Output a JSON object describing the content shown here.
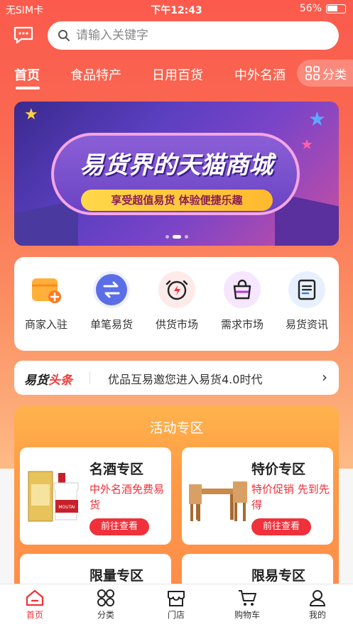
{
  "status": {
    "carrier": "无SIM卡",
    "time": "下午12:43",
    "battery": "56%"
  },
  "search": {
    "placeholder": "请输入关键字"
  },
  "tabs": [
    {
      "label": "首页"
    },
    {
      "label": "食品特产"
    },
    {
      "label": "日用百货"
    },
    {
      "label": "中外名酒"
    }
  ],
  "category_button": "分类",
  "banner": {
    "title": "易货界的天猫商城",
    "subtitle": "享受超值易货 体验便捷乐趣"
  },
  "quick_icons": [
    {
      "label": "商家入驻",
      "icon": "store-plus-icon",
      "color": "#ff9f2e"
    },
    {
      "label": "单笔易货",
      "icon": "swap-arrows-icon",
      "color": "#5b6ee8"
    },
    {
      "label": "供货市场",
      "icon": "alarm-bolt-icon",
      "color": "#f0303a"
    },
    {
      "label": "需求市场",
      "icon": "shopping-bag-icon",
      "color": "#b03ad8"
    },
    {
      "label": "易货资讯",
      "icon": "document-icon",
      "color": "#3a7ee8"
    }
  ],
  "news": {
    "brand_a": "易货",
    "brand_b": "头条",
    "text": "优品互易邀您进入易货4.0时代"
  },
  "activity": {
    "title": "活动专区",
    "cards": [
      {
        "name": "名酒专区",
        "desc": "中外名酒免费易货",
        "button": "前往查看",
        "image_label": "MOUTAI"
      },
      {
        "name": "特价专区",
        "desc": "特价促销 先到先得",
        "button": "前往查看"
      },
      {
        "name": "限量专区"
      },
      {
        "name": "限易专区"
      }
    ]
  },
  "tabbar": [
    {
      "label": "首页"
    },
    {
      "label": "分类"
    },
    {
      "label": "门店"
    },
    {
      "label": "购物车"
    },
    {
      "label": "我的"
    }
  ],
  "colors": {
    "accent": "#f0303a",
    "header_top": "#fb5a4c"
  }
}
